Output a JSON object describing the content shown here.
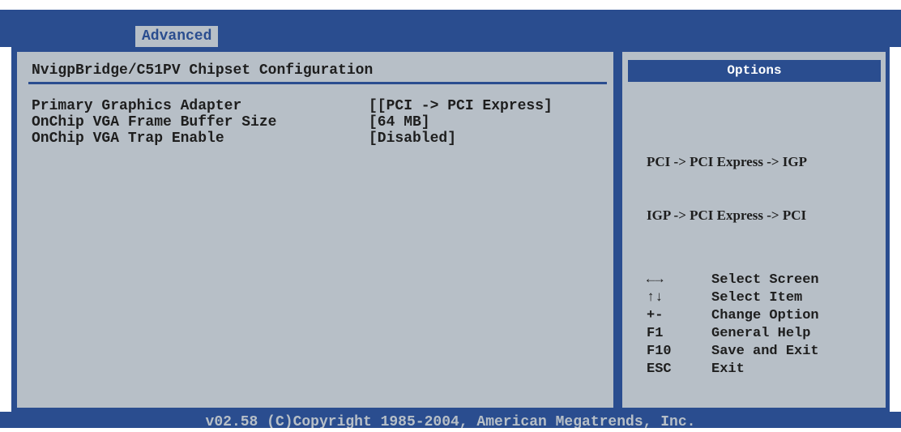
{
  "tabs": {
    "active": "Advanced"
  },
  "main": {
    "title": "NvigpBridge/C51PV Chipset Configuration",
    "settings": [
      {
        "label": "Primary Graphics Adapter",
        "value": "[[PCI -> PCI Express]"
      },
      {
        "label": "OnChip VGA Frame Buffer Size",
        "value": "[64 MB]"
      },
      {
        "label": "OnChip VGA Trap Enable",
        "value": "[Disabled]"
      }
    ]
  },
  "options": {
    "header": "Options",
    "items": [
      "PCI -> PCI Express -> IGP",
      "IGP -> PCI Express -> PCI"
    ]
  },
  "help": {
    "keys": [
      {
        "key": "←→",
        "desc": "Select Screen"
      },
      {
        "key": "↑↓",
        "desc": "Select Item"
      },
      {
        "key": "+-",
        "desc": "Change Option"
      },
      {
        "key": "F1",
        "desc": "General Help"
      },
      {
        "key": "F10",
        "desc": "Save and Exit"
      },
      {
        "key": "ESC",
        "desc": "Exit"
      }
    ]
  },
  "footer": {
    "text": "v02.58 (C)Copyright 1985-2004, American Megatrends, Inc."
  },
  "colors": {
    "bios_blue": "#2a4d8f",
    "panel_gray": "#b7bfc7",
    "text": "#1e1e1e"
  }
}
